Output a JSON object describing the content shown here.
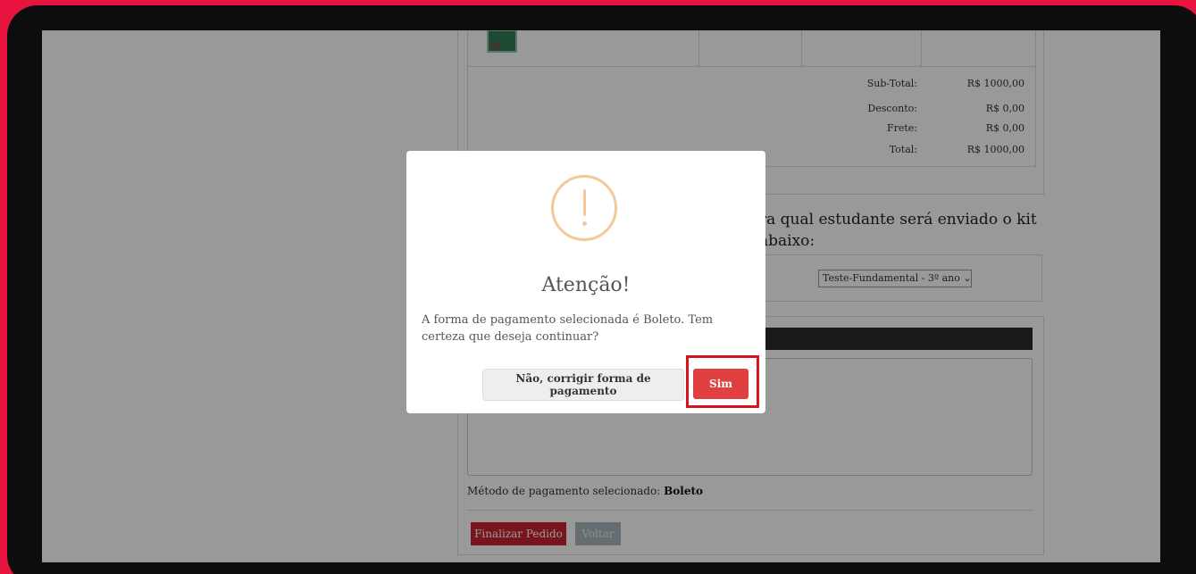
{
  "order": {
    "subtotal_label": "Sub-Total:",
    "subtotal_value": "R$ 1000,00",
    "discount_label": "Desconto:",
    "discount_value": "R$ 0,00",
    "shipping_label": "Frete:",
    "shipping_value": "R$ 0,00",
    "total_label": "Total:",
    "total_value": "R$ 1000,00"
  },
  "kit": {
    "prompt_line1": "ra qual estudante será enviado o kit",
    "prompt_line2": "abaixo:",
    "selected_student": "Teste-Fundamental - 3º ano"
  },
  "payment": {
    "method_label": "Método de pagamento selecionado:",
    "method_value": "Boleto",
    "finalize_button": "Finalizar Pedido",
    "back_button": "Voltar"
  },
  "modal": {
    "icon": "exclamation-warning-icon",
    "title": "Atenção!",
    "message": "A forma de pagamento selecionada é Boleto. Tem certeza que deseja continuar?",
    "cancel_button": "Não, corrigir forma de pagamento",
    "confirm_button": "Sim"
  },
  "colors": {
    "background": "#e8143f",
    "confirm": "#e04040",
    "finalize": "#c7222f",
    "warning": "#f4c99a",
    "highlight": "#d9141e"
  }
}
